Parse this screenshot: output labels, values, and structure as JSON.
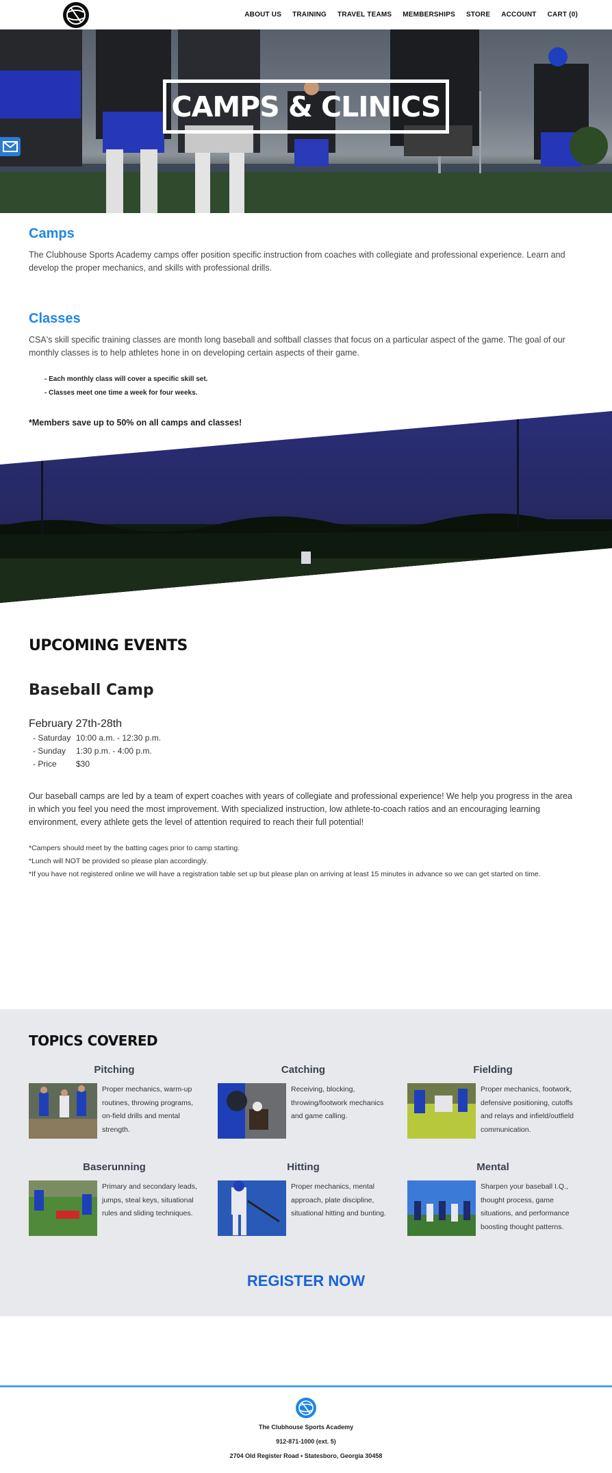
{
  "nav": {
    "items": [
      {
        "label": "ABOUT US"
      },
      {
        "label": "TRAINING"
      },
      {
        "label": "TRAVEL TEAMS"
      },
      {
        "label": "MEMBERSHIPS"
      },
      {
        "label": "STORE"
      },
      {
        "label": "ACCOUNT"
      },
      {
        "label": "CART (0)"
      }
    ]
  },
  "hero": {
    "title": "CAMPS & CLINICS"
  },
  "camps": {
    "heading": "Camps",
    "text": "The Clubhouse Sports Academy camps offer position specific instruction from coaches with collegiate and professional experience.  Learn and develop the proper mechanics, and skills with professional drills."
  },
  "classes": {
    "heading": "Classes",
    "text": "CSA's skill specific training classes are month long baseball and softball classes that focus on a particular aspect of the game. The goal of our monthly classes is to help athletes hone in on developing certain aspects of their game.",
    "bullets": [
      "- Each monthly class will cover a specific skill set.",
      "- Classes meet one time a week for four weeks."
    ],
    "members_note": "*Members save up to 50% on all camps and classes!"
  },
  "events": {
    "heading": "UPCOMING EVENTS",
    "camp_title": "Baseball Camp",
    "date": "February 27th-28th",
    "schedule": [
      {
        "label": "- Saturday",
        "value": "10:00 a.m. - 12:30 p.m."
      },
      {
        "label": "- Sunday",
        "value": "1:30 p.m. - 4:00 p.m."
      },
      {
        "label": "- Price",
        "value": "$30"
      }
    ],
    "description": "Our baseball camps are led by a team of expert coaches with years of collegiate and professional experience! We help you progress in the area in which you feel you need the most improvement. With specialized instruction, low athlete-to-coach ratios and an encouraging learning environment, every athlete gets the level of attention required to reach their full potential!",
    "notes": [
      "*Campers should meet by the batting cages prior to camp starting.",
      "*Lunch will NOT be provided so please plan accordingly.",
      "*If you have not registered online we will have a registration table set up but please plan on arriving at least 15 minutes in advance so we can get started on time."
    ]
  },
  "topics": {
    "heading": "TOPICS COVERED",
    "items": [
      {
        "title": "Pitching",
        "desc": "Proper mechanics, warm-up routines, throwing programs, on-field drills and mental strength."
      },
      {
        "title": "Catching",
        "desc": "Receiving, blocking, throwing/footwork mechanics and game calling."
      },
      {
        "title": "Fielding",
        "desc": "Proper mechanics, footwork, defensive positioning, cutoffs and relays and infield/outfield communication."
      },
      {
        "title": "Baserunning",
        "desc": "Primary and secondary leads, jumps, steal keys, situational rules and sliding techniques."
      },
      {
        "title": "Hitting",
        "desc": "Proper mechanics, mental approach, plate discipline, situational hitting and bunting."
      },
      {
        "title": "Mental",
        "desc": "Sharpen your baseball I.Q., thought process, game situations, and performance boosting thought patterns."
      }
    ],
    "register_label": "REGISTER NOW"
  },
  "footer": {
    "name": "The Clubhouse Sports Academy",
    "phone": "912-871-1000 (ext. 5)",
    "address": "2704 Old Register Road • Statesboro, Georgia 30458"
  },
  "colors": {
    "accent_blue": "#1f86e4",
    "register_blue": "#1a63d8",
    "topics_bg": "#e8e9ec",
    "night_sky": "#2b2f73"
  },
  "icons": [
    "globe-logo-icon",
    "mail-icon"
  ]
}
